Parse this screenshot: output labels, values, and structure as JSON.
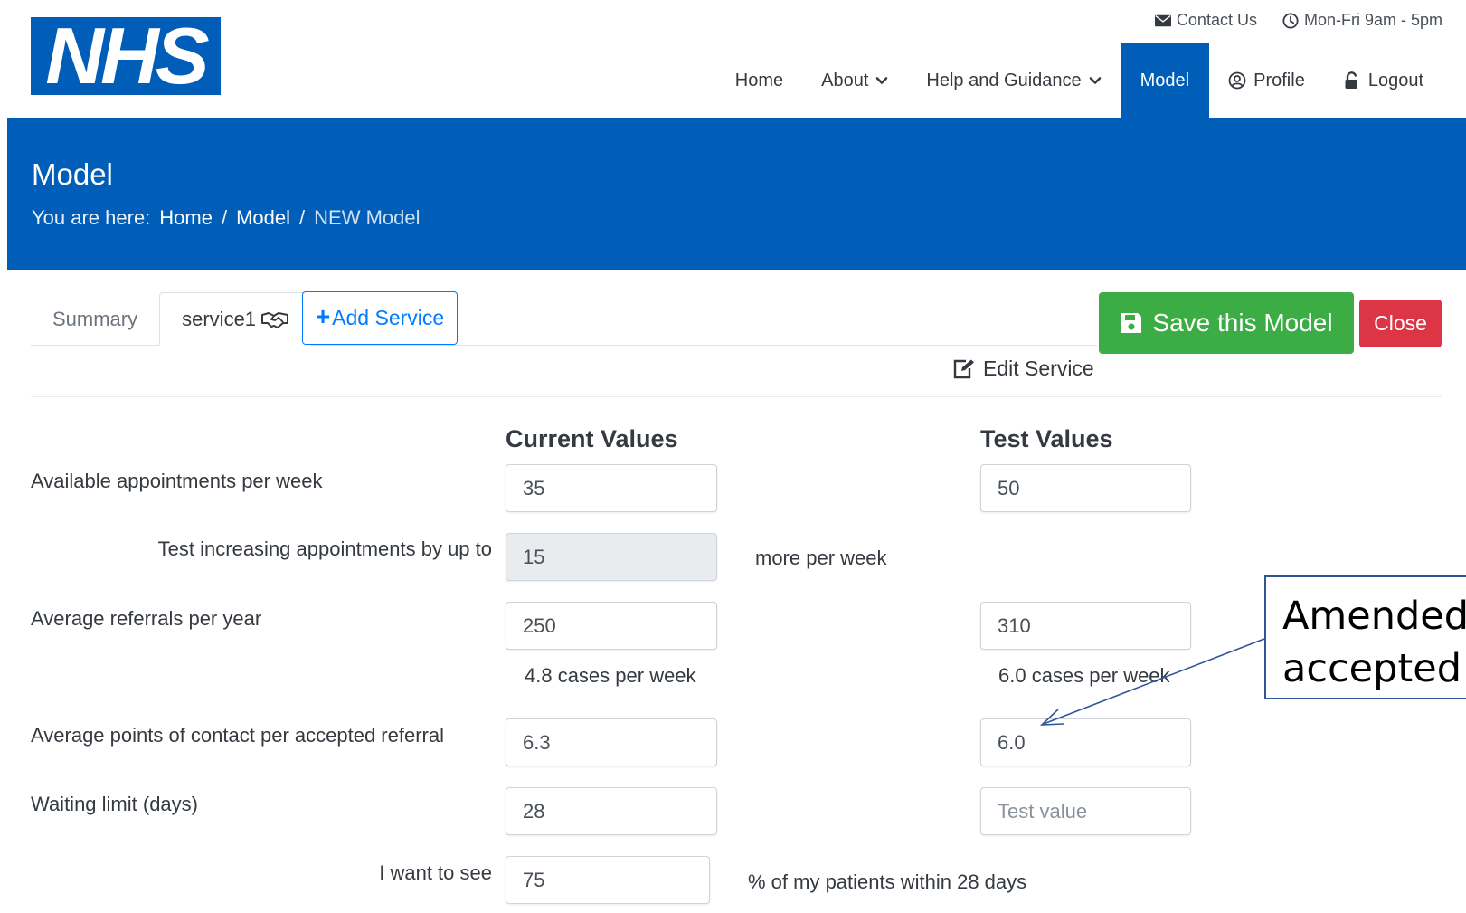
{
  "header": {
    "logo_text": "NHS",
    "topbar": {
      "contact": "Contact Us",
      "hours": "Mon-Fri 9am - 5pm"
    },
    "nav": {
      "home": "Home",
      "about": "About",
      "help": "Help and Guidance",
      "model": "Model",
      "profile": "Profile",
      "logout": "Logout"
    }
  },
  "banner": {
    "title": "Model",
    "breadcrumb_prefix": "You are here:",
    "crumbs": [
      "Home",
      "Model",
      "NEW Model"
    ],
    "separator": "/"
  },
  "tabs": {
    "summary": "Summary",
    "service1": "service1",
    "add_service": "Add Service"
  },
  "actions": {
    "save": "Save this Model",
    "close": "Close",
    "edit_service": "Edit Service"
  },
  "form": {
    "current_header": "Current Values",
    "test_header": "Test Values",
    "available_label": "Available appointments per week",
    "available_current": "35",
    "available_test": "50",
    "increase_label": "Test increasing appointments by up to",
    "increase_value": "15",
    "increase_suffix": "more per week",
    "referrals_label": "Average referrals per year",
    "referrals_current": "250",
    "referrals_test": "310",
    "referrals_current_note": "4.8 cases per week",
    "referrals_test_note": "6.0 cases per week",
    "contact_label": "Average points of contact per accepted referral",
    "contact_current": "6.3",
    "contact_test": "6.0",
    "waiting_label": "Waiting limit (days)",
    "waiting_current": "28",
    "waiting_test_placeholder": "Test value",
    "see_label": "I want to see",
    "see_value": "75",
    "see_suffix": "% of my patients within 28 days"
  },
  "callout": {
    "text": "Amended a\naccepted r"
  },
  "colors": {
    "nhs_blue": "#005EB8",
    "save_green": "#3cad44",
    "close_red": "#dc3545",
    "link_blue": "#007bff"
  }
}
